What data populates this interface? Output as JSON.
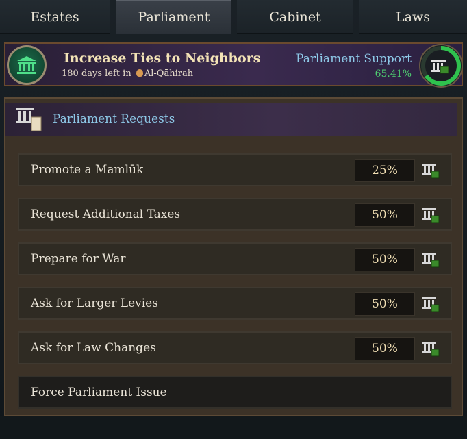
{
  "tabs": [
    {
      "label": "Estates",
      "active": false
    },
    {
      "label": "Parliament",
      "active": true
    },
    {
      "label": "Cabinet",
      "active": false
    },
    {
      "label": "Laws",
      "active": false
    }
  ],
  "header": {
    "title": "Increase Ties to Neighbors",
    "subtitle_prefix": "180 days left in",
    "location": "Al-Qāhirah",
    "support_label": "Parliament Support",
    "support_value": "65.41%",
    "support_fraction": 0.6541,
    "emblem_icon": "parliament-building-icon"
  },
  "panel": {
    "title": "Parliament Requests",
    "title_icon": "parliament-scroll-icon",
    "rows": [
      {
        "label": "Promote a Mamlūk",
        "percent": "25%",
        "icon": "parliament-approve-icon"
      },
      {
        "label": "Request Additional Taxes",
        "percent": "50%",
        "icon": "parliament-approve-icon"
      },
      {
        "label": "Prepare for War",
        "percent": "50%",
        "icon": "parliament-approve-icon"
      },
      {
        "label": "Ask for Larger Levies",
        "percent": "50%",
        "icon": "parliament-approve-icon"
      },
      {
        "label": "Ask for Law Changes",
        "percent": "50%",
        "icon": "parliament-approve-icon"
      }
    ],
    "force_label": "Force Parliament Issue"
  },
  "colors": {
    "title_gold": "#f3e3b6",
    "support_blue": "#8ec9e8",
    "support_green": "#4ecb70"
  }
}
